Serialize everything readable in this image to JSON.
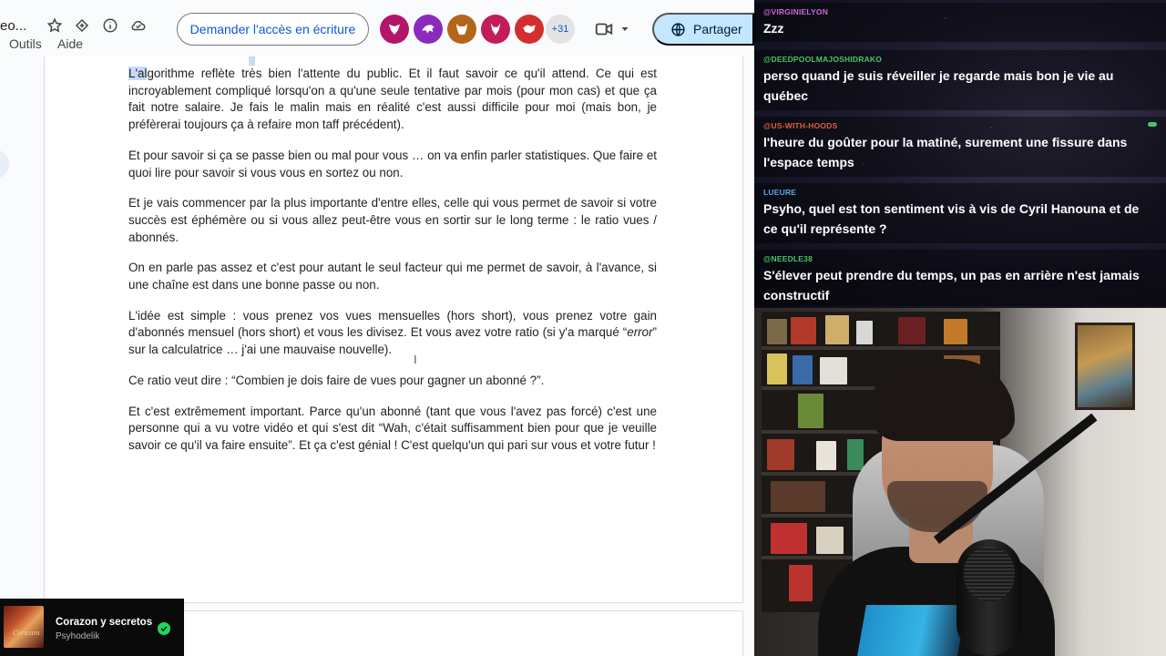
{
  "docs": {
    "title_fragment": "eo...",
    "menu": {
      "tools": "Outils",
      "help": "Aide"
    },
    "request_access_label": "Demander l'accès en écriture",
    "more_collaborators": "+31",
    "share_label": "Partager",
    "paragraphs": [
      {
        "highlight": "L'al",
        "text": "gorithme reflète très bien l'attente du public. Et il faut savoir ce qu'il attend. Ce qui est incroyablement compliqué lorsqu'on a qu'une seule tentative par mois (pour mon cas) et que ça fait notre salaire. Je fais le malin mais en réalité c'est aussi difficile pour moi (mais bon, je préfèrerai toujours ça à refaire mon taff précédent)."
      },
      {
        "text": "Et pour savoir si ça se passe bien ou mal pour vous … on va enfin parler statistiques. Que faire et quoi lire pour savoir si vous vous en sortez ou non."
      },
      {
        "text": "Et je vais commencer par la plus importante d'entre elles, celle qui vous permet de savoir si votre succès est éphémère ou si vous allez peut-être vous en sortir sur le long terme : le ratio vues / abonnés."
      },
      {
        "text": "On en parle pas assez et c'est pour autant le seul facteur qui me permet de savoir, à l'avance, si une chaîne est dans une bonne passe ou non."
      },
      {
        "before": "L'idée est simple : vous prenez vos vues mensuelles (hors short), vous prenez votre gain d'abonnés mensuel (hors short) et vous les divisez. Et vous avez votre ratio (si y'a marqué “",
        "italic": "error",
        "after": "” sur la calculatrice … j'ai une mauvaise nouvelle)."
      },
      {
        "text": "Ce ratio veut dire : “Combien je dois faire de vues pour gagner un abonné ?”."
      },
      {
        "text": "Et c'est extrêmement important. Parce qu'un abonné (tant que vous l'avez pas forcé) c'est une personne qui a vu votre vidéo et qui s'est dit “Wah, c'était suffisamment bien pour que je veuille savoir ce qu'il va faire ensuite”. Et ça c'est génial ! C'est quelqu'un qui pari sur vous et votre futur !"
      }
    ]
  },
  "spotify": {
    "song": "Corazon y secretos",
    "artist": "Psyhodelik",
    "accent": "#1ed760"
  },
  "chat": {
    "messages": [
      {
        "user": "@VIRGINIELYON",
        "color": "#c86bd6",
        "text": "Zzz"
      },
      {
        "user": "@DEEDPOOLMAJOSHIDRAKO",
        "color": "#44c767",
        "text": "perso quand je suis réveiller je regarde mais bon je vie au québec"
      },
      {
        "user": "@US-WITH-HOODS",
        "color": "#e0603a",
        "text": "l'heure du goûter pour la matiné, surement une fissure dans l'espace temps"
      },
      {
        "user": "LUEURE",
        "color": "#5aa7e6",
        "text": "Psyho, quel est ton sentiment vis à vis de Cyril Hanouna et de ce qu'il représente ?"
      },
      {
        "user": "@NEEDLE38",
        "color": "#44c767",
        "text": "S'élever peut prendre du temps, un pas en arrière n'est jamais constructif"
      }
    ]
  }
}
